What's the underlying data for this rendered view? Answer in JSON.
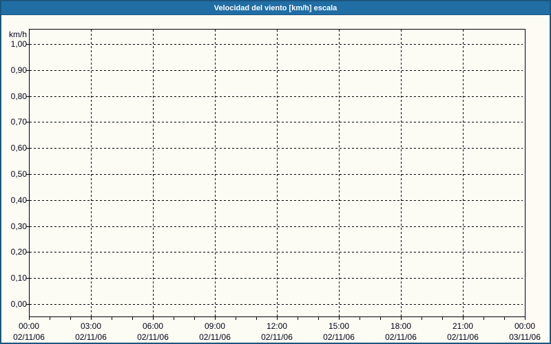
{
  "title": "Velocidad del viento [km/h] escala",
  "colors": {
    "titlebar_bg": "#216EA5",
    "outer_border": "#1B567F",
    "background": "#FCFCF5",
    "grid": "#000000",
    "axis": "#000000",
    "label_text": "#000014",
    "title_text": "#FFFFFF"
  },
  "chart_data": {
    "type": "line",
    "title": "Velocidad del viento [km/h] escala",
    "ylabel": "km/h",
    "ylim": [
      0.0,
      1.0
    ],
    "y_tick_step": 0.1,
    "y_tick_labels": [
      "1,00",
      "0,90",
      "0,80",
      "0,70",
      "0,60",
      "0,50",
      "0,40",
      "0,30",
      "0,20",
      "0,10",
      "0,00"
    ],
    "x_range_hours": 24,
    "x_major_step_hours": 3,
    "x_minor_step_hours": 1,
    "x_tick_times": [
      "00:00",
      "03:00",
      "06:00",
      "09:00",
      "12:00",
      "15:00",
      "18:00",
      "21:00",
      "00:00"
    ],
    "x_tick_dates": [
      "02/11/06",
      "02/11/06",
      "02/11/06",
      "02/11/06",
      "02/11/06",
      "02/11/06",
      "02/11/06",
      "02/11/06",
      "03/11/06"
    ],
    "grid": "dashed",
    "legend": "none",
    "series": []
  }
}
